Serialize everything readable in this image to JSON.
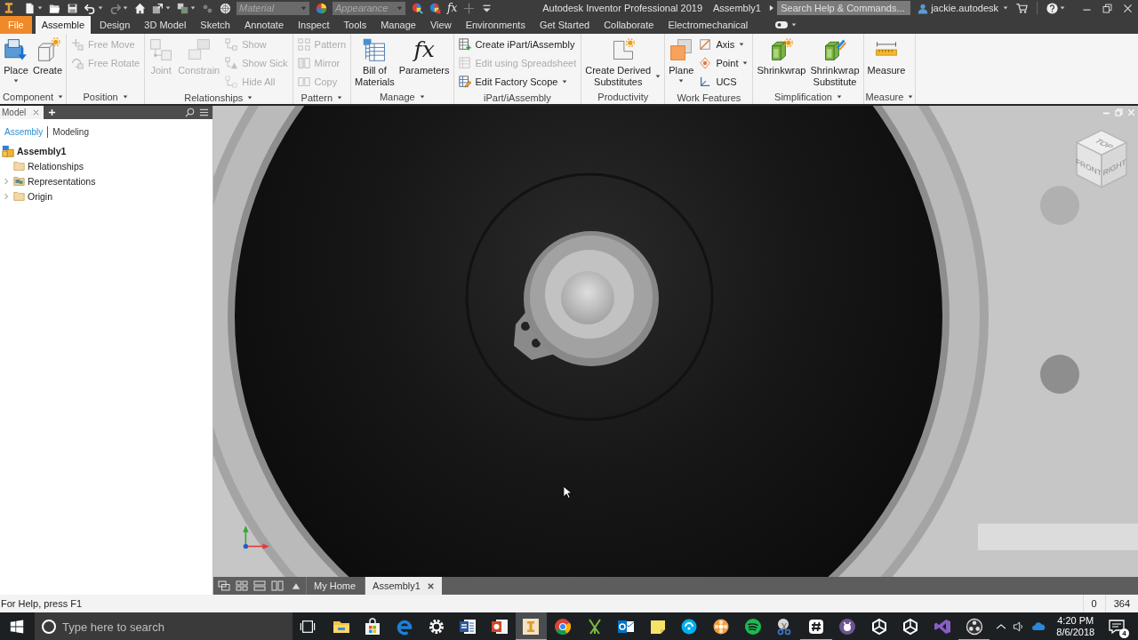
{
  "title_bar": {
    "quick_access": [
      {
        "menu": true,
        "disabled": false
      },
      {
        "menu": false,
        "disabled": false
      },
      {
        "menu": false,
        "disabled": false
      },
      {
        "menu": true,
        "disabled": false
      },
      {
        "menu": true,
        "disabled": true
      },
      {
        "menu": false,
        "disabled": false
      },
      {
        "menu": true,
        "disabled": false
      },
      {
        "menu": true,
        "disabled": false
      },
      {
        "menu": false,
        "disabled": true
      },
      {
        "menu": false,
        "disabled": false
      }
    ],
    "material": {
      "placeholder": "Material",
      "disabled": true
    },
    "appearance": {
      "placeholder": "Appearance",
      "disabled": true
    },
    "appearance_tools": [
      {
        "disabled": false
      },
      {
        "disabled": false
      },
      {
        "glyph": "fx",
        "disabled": false
      },
      {
        "disabled": true
      },
      {
        "disabled": false
      }
    ],
    "app_title": "Autodesk Inventor Professional 2019",
    "document_title": "Assembly1",
    "search": {
      "placeholder": "Search Help & Commands..."
    },
    "user": "jackie.autodesk"
  },
  "ribbon_tabs": [
    {
      "label": "File",
      "kind": "file",
      "selected": false
    },
    {
      "label": "Assemble",
      "kind": "tab",
      "selected": true
    },
    {
      "label": "Design",
      "kind": "tab",
      "selected": false
    },
    {
      "label": "3D Model",
      "kind": "tab",
      "selected": false
    },
    {
      "label": "Sketch",
      "kind": "tab",
      "selected": false
    },
    {
      "label": "Annotate",
      "kind": "tab",
      "selected": false
    },
    {
      "label": "Inspect",
      "kind": "tab",
      "selected": false
    },
    {
      "label": "Tools",
      "kind": "tab",
      "selected": false
    },
    {
      "label": "Manage",
      "kind": "tab",
      "selected": false
    },
    {
      "label": "View",
      "kind": "tab",
      "selected": false
    },
    {
      "label": "Environments",
      "kind": "tab",
      "selected": false
    },
    {
      "label": "Get Started",
      "kind": "tab",
      "selected": false
    },
    {
      "label": "Collaborate",
      "kind": "tab",
      "selected": false
    },
    {
      "label": "Electromechanical",
      "kind": "tab",
      "selected": false
    }
  ],
  "ribbon_panels": [
    {
      "title": "Component",
      "menu": true,
      "tools": [
        {
          "label": "Place",
          "kind": "large",
          "menu": true,
          "disabled": false
        },
        {
          "label": "Create",
          "kind": "large",
          "menu": false,
          "disabled": false
        }
      ]
    },
    {
      "title": "Position",
      "menu": true,
      "tools": [
        {
          "label": "Free Move",
          "kind": "small",
          "menu": false,
          "disabled": true
        },
        {
          "label": "Free Rotate",
          "kind": "small",
          "menu": false,
          "disabled": true
        }
      ]
    },
    {
      "title": "Relationships",
      "menu": true,
      "tools": [
        {
          "label": "Joint",
          "kind": "large",
          "menu": false,
          "disabled": true
        },
        {
          "label": "Constrain",
          "kind": "large",
          "menu": false,
          "disabled": true
        },
        {
          "label": "Show",
          "kind": "small",
          "menu": false,
          "disabled": true
        },
        {
          "label": "Show Sick",
          "kind": "small",
          "menu": false,
          "disabled": true
        },
        {
          "label": "Hide All",
          "kind": "small",
          "menu": false,
          "disabled": true
        }
      ]
    },
    {
      "title": "Pattern",
      "menu": true,
      "tools": [
        {
          "label": "Pattern",
          "kind": "small",
          "menu": false,
          "disabled": true
        },
        {
          "label": "Mirror",
          "kind": "small",
          "menu": false,
          "disabled": true
        },
        {
          "label": "Copy",
          "kind": "small",
          "menu": false,
          "disabled": true
        }
      ]
    },
    {
      "title": "Manage",
      "menu": true,
      "tools": [
        {
          "label": "Bill of\nMaterials",
          "kind": "large",
          "menu": false,
          "disabled": false
        },
        {
          "label": "Parameters",
          "kind": "large",
          "glyph": "fx",
          "menu": false,
          "disabled": false
        }
      ]
    },
    {
      "title": "iPart/iAssembly",
      "menu": false,
      "tools": [
        {
          "label": "Create iPart/iAssembly",
          "kind": "small",
          "menu": false,
          "disabled": false
        },
        {
          "label": "Edit using Spreadsheet",
          "kind": "small",
          "menu": false,
          "disabled": true
        },
        {
          "label": "Edit Factory Scope",
          "kind": "small",
          "menu": true,
          "disabled": false
        }
      ]
    },
    {
      "title": "Productivity",
      "menu": false,
      "tools": [
        {
          "label": "Create Derived\nSubstitutes",
          "kind": "large",
          "menu": true,
          "disabled": false
        }
      ]
    },
    {
      "title": "Work Features",
      "menu": false,
      "tools": [
        {
          "label": "Plane",
          "kind": "large",
          "menu": true,
          "disabled": false
        },
        {
          "label": "Axis",
          "kind": "small",
          "menu": true,
          "disabled": false
        },
        {
          "label": "Point",
          "kind": "small",
          "menu": true,
          "disabled": false
        },
        {
          "label": "UCS",
          "kind": "small",
          "menu": false,
          "disabled": false
        }
      ]
    },
    {
      "title": "Simplification",
      "menu": true,
      "tools": [
        {
          "label": "Shrinkwrap",
          "kind": "large",
          "menu": false,
          "disabled": false
        },
        {
          "label": "Shrinkwrap\nSubstitute",
          "kind": "large",
          "menu": false,
          "disabled": false
        }
      ]
    },
    {
      "title": "Measure",
      "menu": true,
      "tools": [
        {
          "label": "Measure",
          "kind": "large",
          "menu": false,
          "disabled": false
        }
      ]
    }
  ],
  "browser": {
    "tabs": [
      {
        "label": "Model",
        "selected": true,
        "closable": true
      }
    ],
    "modes": [
      {
        "label": "Assembly",
        "selected": true
      },
      {
        "label": "Modeling",
        "selected": false
      }
    ],
    "tree": [
      {
        "label": "Assembly1",
        "kind": "assembly",
        "expandable": false,
        "children": [
          {
            "label": "Relationships",
            "kind": "folder",
            "expandable": false
          },
          {
            "label": "Representations",
            "kind": "representations",
            "expandable": true
          },
          {
            "label": "Origin",
            "kind": "folder",
            "expandable": true
          }
        ]
      }
    ]
  },
  "viewport": {
    "view_cube": {
      "faces": [
        "TOP",
        "FRONT",
        "RIGHT"
      ]
    }
  },
  "doc_tabs": [
    {
      "label": "My Home",
      "selected": false,
      "closable": false
    },
    {
      "label": "Assembly1",
      "selected": true,
      "closable": true
    }
  ],
  "status_bar": {
    "help": "For Help, press F1",
    "fields": [
      "0",
      "364"
    ]
  },
  "taskbar": {
    "search": {
      "placeholder": "Type here to search"
    },
    "apps": [
      {
        "selected": false,
        "running": false
      },
      {
        "selected": false,
        "running": false
      },
      {
        "selected": false,
        "running": false
      },
      {
        "selected": false,
        "running": false
      },
      {
        "selected": false,
        "running": false
      },
      {
        "selected": false,
        "running": false
      },
      {
        "selected": true,
        "running": true
      },
      {
        "selected": false,
        "running": false
      },
      {
        "selected": false,
        "running": false
      },
      {
        "selected": false,
        "running": false
      },
      {
        "selected": false,
        "running": false
      },
      {
        "selected": false,
        "running": false
      },
      {
        "selected": false,
        "running": false
      },
      {
        "selected": false,
        "running": false
      },
      {
        "selected": false,
        "running": false
      },
      {
        "selected": false,
        "running": true
      },
      {
        "selected": false,
        "running": false
      },
      {
        "selected": false,
        "running": false
      },
      {
        "selected": false,
        "running": false
      },
      {
        "selected": false,
        "running": false
      },
      {
        "selected": false,
        "running": true
      }
    ],
    "time": "4:20 PM",
    "date": "8/6/2018",
    "notifications": "4"
  }
}
